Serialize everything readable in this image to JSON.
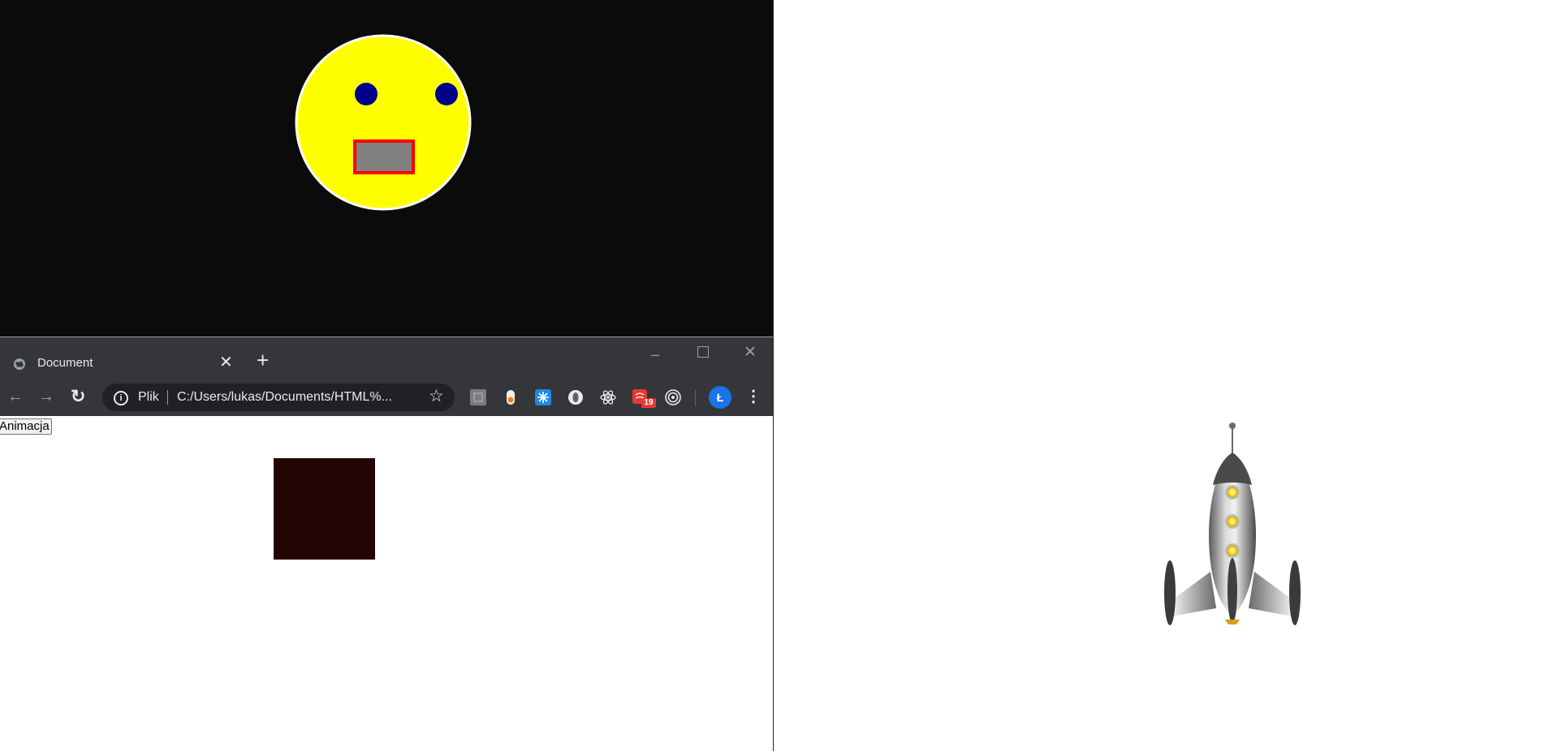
{
  "browser": {
    "tab": {
      "title": "Document"
    },
    "address": {
      "security_label": "Plik",
      "url": "C:/Users/lukas/Documents/HTML%..."
    },
    "extensions": [
      {
        "icon": "gray-square-extension-icon"
      },
      {
        "icon": "toggle-extension-icon"
      },
      {
        "icon": "snowflake-extension-icon"
      },
      {
        "icon": "circle-extension-icon"
      },
      {
        "icon": "react-devtools-icon"
      },
      {
        "icon": "calendar-extension-icon",
        "badge": "19"
      },
      {
        "icon": "target-extension-icon"
      }
    ],
    "profile_initial": "Ł"
  },
  "page": {
    "button_label": "Animacja",
    "box_color": "#230503"
  },
  "colors": {
    "face": "#ffff00",
    "eyes": "#00008b",
    "mouth_fill": "#808080",
    "mouth_border": "#ff0000",
    "canvas_bg": "#0c0b0c",
    "chrome_bg": "#35363a",
    "omnibox_bg": "#202124"
  }
}
